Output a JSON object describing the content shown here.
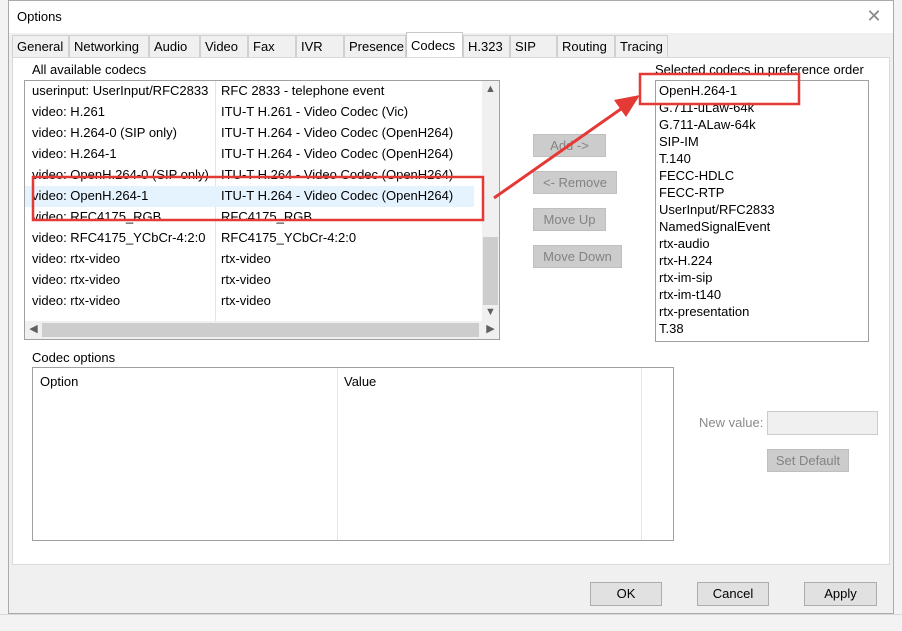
{
  "window": {
    "title": "Options",
    "close_glyph": "✕"
  },
  "tabs": [
    {
      "label": "General"
    },
    {
      "label": "Networking"
    },
    {
      "label": "Audio"
    },
    {
      "label": "Video"
    },
    {
      "label": "Fax"
    },
    {
      "label": "IVR"
    },
    {
      "label": "Presence"
    },
    {
      "label": "Codecs"
    },
    {
      "label": "H.323"
    },
    {
      "label": "SIP"
    },
    {
      "label": "Routing"
    },
    {
      "label": "Tracing"
    }
  ],
  "active_tab": "Codecs",
  "available": {
    "label": "All available codecs",
    "rows": [
      {
        "name": "userinput: UserInput/RFC2833",
        "desc": "RFC 2833 - telephone event"
      },
      {
        "name": "video: H.261",
        "desc": "ITU-T H.261 - Video Codec (Vic)"
      },
      {
        "name": "video: H.264-0 (SIP only)",
        "desc": "ITU-T H.264 - Video Codec (OpenH264)"
      },
      {
        "name": "video: H.264-1",
        "desc": "ITU-T H.264 - Video Codec (OpenH264)"
      },
      {
        "name": "video: OpenH.264-0 (SIP only)",
        "desc": "ITU-T H.264 - Video Codec (OpenH264)"
      },
      {
        "name": "video: OpenH.264-1",
        "desc": "ITU-T H.264 - Video Codec (OpenH264)"
      },
      {
        "name": "video: RFC4175_RGB",
        "desc": "RFC4175_RGB"
      },
      {
        "name": "video: RFC4175_YCbCr-4:2:0",
        "desc": "RFC4175_YCbCr-4:2:0"
      },
      {
        "name": "video: rtx-video",
        "desc": "rtx-video"
      },
      {
        "name": "video: rtx-video",
        "desc": "rtx-video"
      },
      {
        "name": "video: rtx-video",
        "desc": "rtx-video"
      }
    ],
    "selected_row": 5,
    "scroll_up_glyph": "▲",
    "scroll_down_glyph": "▼",
    "scroll_left_glyph": "◀",
    "scroll_right_glyph": "▶"
  },
  "actions": {
    "add": "Add ->",
    "remove": "<- Remove",
    "move_up": "Move Up",
    "move_down": "Move Down"
  },
  "selected": {
    "label": "Selected codecs in preference order",
    "items": [
      "OpenH.264-1",
      "G.711-uLaw-64k",
      "G.711-ALaw-64k",
      "SIP-IM",
      "T.140",
      "FECC-HDLC",
      "FECC-RTP",
      "UserInput/RFC2833",
      "NamedSignalEvent",
      "rtx-audio",
      "rtx-H.224",
      "rtx-im-sip",
      "rtx-im-t140",
      "rtx-presentation",
      "T.38"
    ]
  },
  "codec_options": {
    "label": "Codec options",
    "col_option": "Option",
    "col_value": "Value"
  },
  "new_value": {
    "label": "New value:",
    "value": ""
  },
  "set_default": "Set Default",
  "footer": {
    "ok": "OK",
    "cancel": "Cancel",
    "apply": "Apply"
  },
  "annotation_color": "#e53935"
}
